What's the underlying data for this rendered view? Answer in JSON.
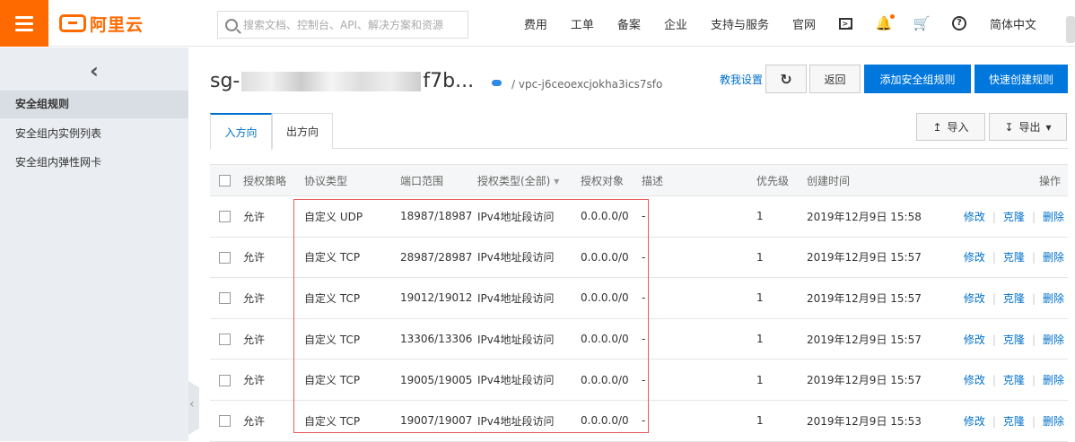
{
  "brand": {
    "logo_text": "阿里云",
    "accent": "#ff6a00"
  },
  "search": {
    "placeholder": "搜索文档、控制台、API、解决方案和资源"
  },
  "topnav": {
    "items": [
      "费用",
      "工单",
      "备案",
      "企业",
      "支持与服务",
      "官网"
    ],
    "language": "简体中文",
    "icons": [
      "terminal-icon",
      "bell-icon",
      "cart-icon",
      "help-icon"
    ]
  },
  "sidebar": {
    "items": [
      {
        "label": "安全组规则",
        "active": true
      },
      {
        "label": "安全组内实例列表",
        "active": false
      },
      {
        "label": "安全组内弹性网卡",
        "active": false
      }
    ]
  },
  "header": {
    "title_prefix": "sg-",
    "title_suffix": "f7b...",
    "vpc": "/ vpc-j6ceoexcjokha3ics7sfo",
    "help_link": "教我设置",
    "back_label": "返回",
    "add_rule_label": "添加安全组规则",
    "quick_create_label": "快速创建规则"
  },
  "tabs": {
    "inbound": "入方向",
    "outbound": "出方向"
  },
  "tools": {
    "import_label": "导入",
    "export_label": "导出"
  },
  "table": {
    "headers": {
      "policy": "授权策略",
      "protocol": "协议类型",
      "port": "端口范围",
      "auth_type": "授权类型(全部)",
      "auth_target": "授权对象",
      "desc": "描述",
      "priority": "优先级",
      "created": "创建时间",
      "ops": "操作"
    },
    "rows": [
      {
        "policy": "允许",
        "protocol": "自定义 UDP",
        "port": "18987/18987",
        "auth_type": "IPv4地址段访问",
        "target": "0.0.0.0/0",
        "desc": "-",
        "priority": "1",
        "created": "2019年12月9日 15:58"
      },
      {
        "policy": "允许",
        "protocol": "自定义 TCP",
        "port": "28987/28987",
        "auth_type": "IPv4地址段访问",
        "target": "0.0.0.0/0",
        "desc": "-",
        "priority": "1",
        "created": "2019年12月9日 15:57"
      },
      {
        "policy": "允许",
        "protocol": "自定义 TCP",
        "port": "19012/19012",
        "auth_type": "IPv4地址段访问",
        "target": "0.0.0.0/0",
        "desc": "-",
        "priority": "1",
        "created": "2019年12月9日 15:57"
      },
      {
        "policy": "允许",
        "protocol": "自定义 TCP",
        "port": "13306/13306",
        "auth_type": "IPv4地址段访问",
        "target": "0.0.0.0/0",
        "desc": "-",
        "priority": "1",
        "created": "2019年12月9日 15:57"
      },
      {
        "policy": "允许",
        "protocol": "自定义 TCP",
        "port": "19005/19005",
        "auth_type": "IPv4地址段访问",
        "target": "0.0.0.0/0",
        "desc": "-",
        "priority": "1",
        "created": "2019年12月9日 15:57"
      },
      {
        "policy": "允许",
        "protocol": "自定义 TCP",
        "port": "19007/19007",
        "auth_type": "IPv4地址段访问",
        "target": "0.0.0.0/0",
        "desc": "-",
        "priority": "1",
        "created": "2019年12月9日 15:53"
      }
    ],
    "row_actions": {
      "edit": "修改",
      "clone": "克隆",
      "delete": "删除"
    }
  }
}
